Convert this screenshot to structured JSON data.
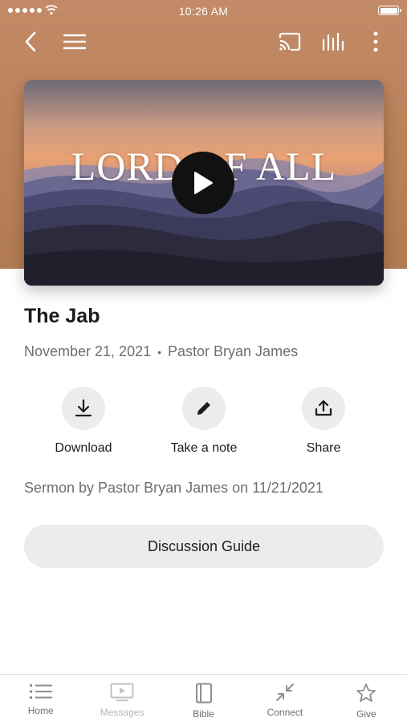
{
  "status_bar": {
    "time": "10:26 AM"
  },
  "nav": {
    "icons": [
      "back-icon",
      "menu-icon",
      "cast-icon",
      "audio-bars-icon",
      "more-vertical-icon"
    ]
  },
  "video": {
    "title": "LORD OF ALL",
    "play_icon": "play-icon"
  },
  "sermon": {
    "title": "The Jab",
    "date": "November 21, 2021",
    "separator": "•",
    "speaker": "Pastor Bryan James",
    "description": "Sermon by Pastor Bryan James on 11/21/2021"
  },
  "actions": [
    {
      "label": "Download",
      "icon": "download-icon"
    },
    {
      "label": "Take a note",
      "icon": "pencil-icon"
    },
    {
      "label": "Share",
      "icon": "share-icon"
    }
  ],
  "discussion_button": {
    "label": "Discussion Guide"
  },
  "tabs": [
    {
      "label": "Home",
      "icon": "list-icon"
    },
    {
      "label": "Messages",
      "icon": "tv-play-icon",
      "state": "disabled"
    },
    {
      "label": "Bible",
      "icon": "book-icon"
    },
    {
      "label": "Connect",
      "icon": "arrows-in-icon"
    },
    {
      "label": "Give",
      "icon": "star-icon"
    }
  ],
  "colors": {
    "header_background": "#c28a66",
    "button_background": "#ececee",
    "secondary_text": "#6e6e73"
  }
}
